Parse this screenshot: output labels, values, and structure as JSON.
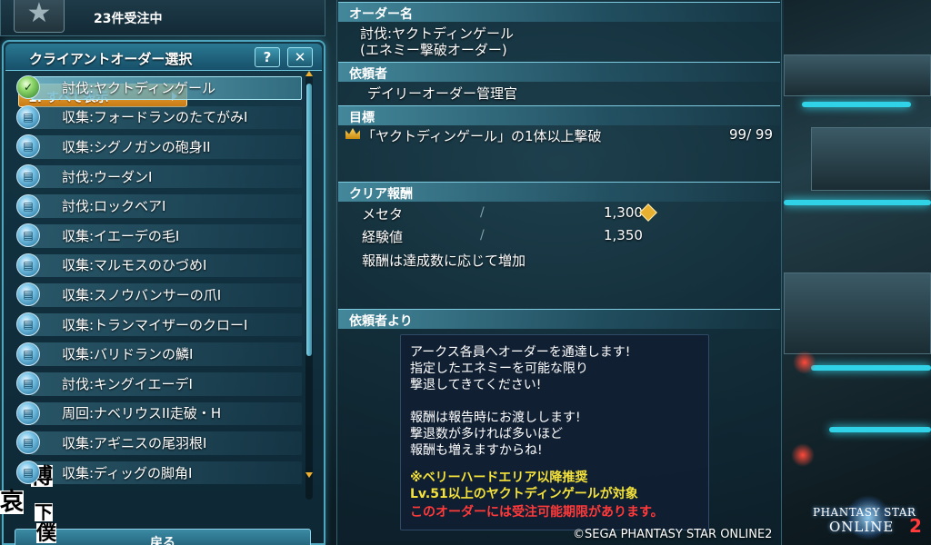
{
  "header": {
    "accepted_count": "23件受注中",
    "star_icon": "star-icon"
  },
  "panel": {
    "title": "クライアントオーダー選択",
    "help_label": "?",
    "close_label": "✕",
    "filter_label": "1. すべて表示",
    "back_label": "戻る"
  },
  "orders": [
    {
      "label": "討伐:ヤクトディンゲール",
      "icon": "check-icon",
      "selected": true
    },
    {
      "label": "収集:フォードランのたてがみI",
      "icon": "order-icon"
    },
    {
      "label": "収集:シグノガンの砲身II",
      "icon": "order-icon"
    },
    {
      "label": "討伐:ウーダンI",
      "icon": "order-icon"
    },
    {
      "label": "討伐:ロックベアI",
      "icon": "order-icon"
    },
    {
      "label": "収集:イエーデの毛I",
      "icon": "order-icon"
    },
    {
      "label": "収集:マルモスのひづめI",
      "icon": "order-icon"
    },
    {
      "label": "収集:スノウバンサーの爪I",
      "icon": "order-icon"
    },
    {
      "label": "収集:トランマイザーのクローI",
      "icon": "order-icon"
    },
    {
      "label": "収集:バリドランの鱗I",
      "icon": "order-icon"
    },
    {
      "label": "討伐:キングイエーデI",
      "icon": "order-icon"
    },
    {
      "label": "周回:ナベリウスII走破・H",
      "icon": "order-icon"
    },
    {
      "label": "収集:アギニスの尾羽根I",
      "icon": "order-icon"
    },
    {
      "label": "収集:ディッグの脚角I",
      "icon": "order-icon"
    }
  ],
  "stamp": [
    "哀",
    "博",
    "下",
    "僕"
  ],
  "detail": {
    "order_name_header": "オーダー名",
    "order_name_line1": "討伐:ヤクトディンゲール",
    "order_name_line2": "(エネミー撃破オーダー)",
    "client_header": "依頼者",
    "client_name": "デイリーオーダー管理官",
    "goal_header": "目標",
    "goal_text": "「ヤクトディンゲール」の1体以上撃破",
    "goal_progress": "99/ 99",
    "reward_header": "クリア報酬",
    "reward_meseta_label": "メセタ",
    "reward_meseta_value": "1,300",
    "reward_exp_label": "経験値",
    "reward_exp_value": "1,350",
    "reward_note": "報酬は達成数に応じて増加",
    "from_client_header": "依頼者より",
    "message": [
      "アークス各員へオーダーを通達します!",
      "指定したエネミーを可能な限り",
      "撃退してきてください!",
      "",
      "報酬は報告時にお渡しします!",
      "撃退数が多ければ多いほど",
      "報酬も増えますからね!"
    ],
    "note_yellow_1": "※ベリーハードエリア以降推奨",
    "note_yellow_2": "Lv.51以上のヤクトディンゲールが対象",
    "note_red": "このオーダーには受注可能期限があります。"
  },
  "footer": {
    "copyright": "©SEGA PHANTASY STAR ONLINE2",
    "logo_line1": "PHANTASY STAR",
    "logo_line2": "ONLINE",
    "logo_num": "2"
  }
}
